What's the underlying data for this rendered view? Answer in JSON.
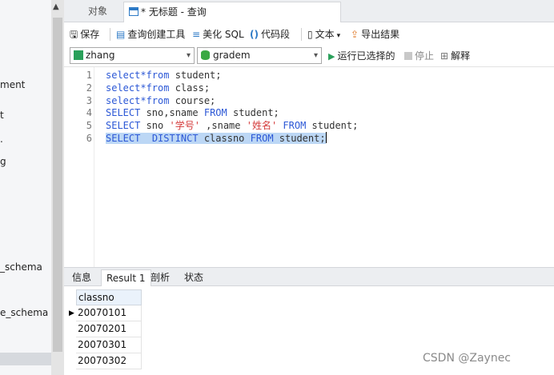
{
  "navigator": {
    "items": [
      {
        "label": "ment"
      },
      {
        "label": "t"
      },
      {
        "label": "."
      },
      {
        "label": "g"
      },
      {
        "label": "_schema"
      },
      {
        "label": "e_schema"
      }
    ]
  },
  "tabs": {
    "objects": "对象",
    "query": "* 无标题 - 查询"
  },
  "toolbar": {
    "save": "保存",
    "query_builder": "查询创建工具",
    "beautify": "美化 SQL",
    "snippet": "代码段",
    "text": "文本",
    "export": "导出结果"
  },
  "connbar": {
    "connection": "zhang",
    "database": "gradem",
    "run_selected": "运行已选择的",
    "stop": "停止",
    "explain": "解释"
  },
  "editor": {
    "line_numbers": [
      "1",
      "2",
      "3",
      "4",
      "5",
      "6"
    ],
    "lines": [
      {
        "a": "select*from",
        "b": " student;"
      },
      {
        "a": "select*from",
        "b": " class;"
      },
      {
        "a": "select*from",
        "b": " course;"
      },
      {
        "kw1": "SELECT",
        "t1": " sno,sname ",
        "kw2": "FROM",
        "t2": " student;"
      },
      {
        "kw1": "SELECT",
        "t1": " sno ",
        "s1": "'学号'",
        "t2": " ,sname ",
        "s2": "'姓名'",
        "t3": " ",
        "kw2": "FROM",
        "t4": " student;"
      },
      {
        "kw1": "SELECT",
        "t1": "  ",
        "kw2": "DISTINCT",
        "t2": " classno ",
        "kw3": "FROM",
        "t3": " student;"
      }
    ]
  },
  "result_tabs": [
    "信息",
    "Result 1",
    "剖析",
    "状态"
  ],
  "result": {
    "column": "classno",
    "rows": [
      "20070101",
      "20070201",
      "20070301",
      "20070302"
    ]
  },
  "watermark": "CSDN @Zaynec",
  "colors": {
    "keyword": "#2c58d6",
    "string": "#d43a3a",
    "selection": "#bcd7f5"
  }
}
